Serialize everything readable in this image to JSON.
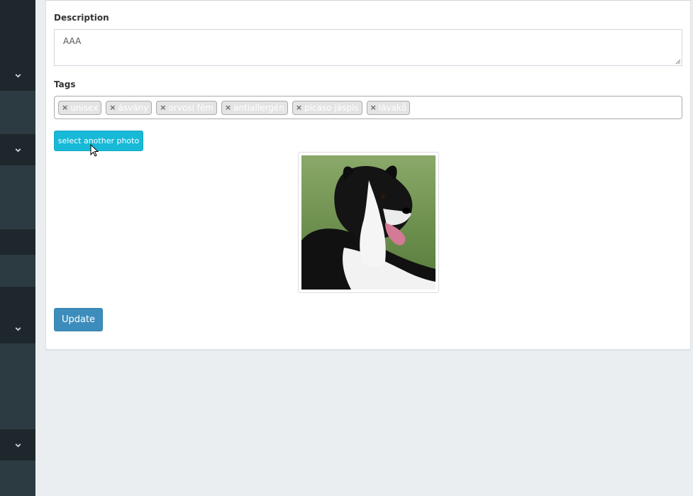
{
  "form": {
    "description_label": "Description",
    "description_value": "AAA",
    "tags_label": "Tags",
    "tags": [
      "unisex",
      "ásvány",
      "orvosi fém",
      "antiallergén",
      "picaso jáspis",
      "lávakő"
    ],
    "select_photo_label": "select another photo",
    "update_label": "Update"
  },
  "colors": {
    "sidebar": "#2c3b41",
    "sidebar_dark": "#1e282c",
    "select_button": "#17b9d7",
    "update_button": "#3c8dbc"
  },
  "icons": {
    "sidebar_toggle": "chevron-down-icon",
    "tag_remove": "close-icon",
    "pointer": "mouse-cursor"
  }
}
